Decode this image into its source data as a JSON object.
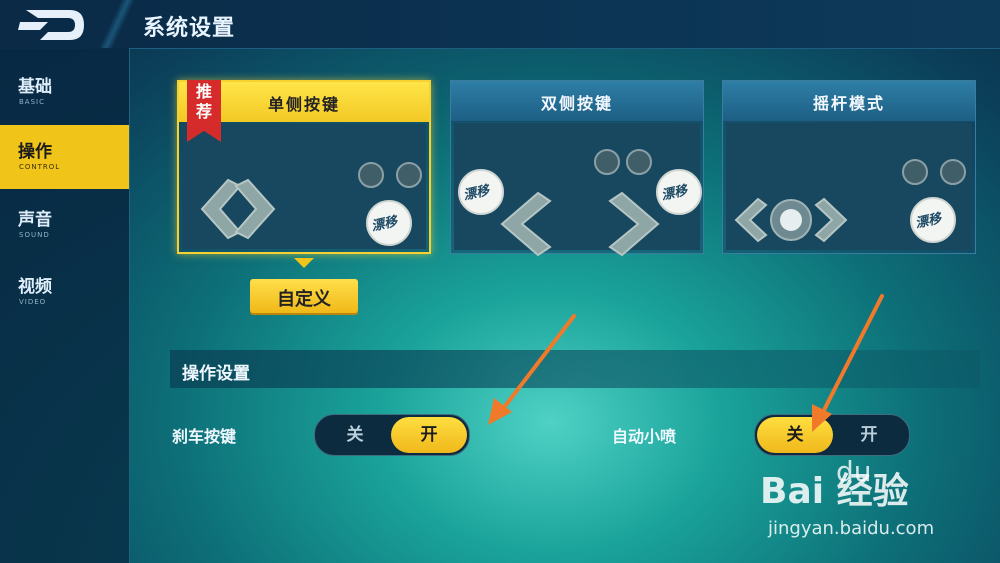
{
  "header": {
    "title": "系统设置"
  },
  "sidebar": {
    "items": [
      {
        "label": "基础",
        "sub": "BASIC",
        "active": false
      },
      {
        "label": "操作",
        "sub": "CONTROL",
        "active": true
      },
      {
        "label": "声音",
        "sub": "SOUND",
        "active": false
      },
      {
        "label": "视频",
        "sub": "VIDEO",
        "active": false
      }
    ]
  },
  "modes": {
    "single": {
      "label": "单侧按键",
      "badge": "推荐",
      "selected": true
    },
    "double": {
      "label": "双侧按键",
      "selected": false
    },
    "joystick": {
      "label": "摇杆模式",
      "selected": false
    },
    "drift_logo_text": "漂移"
  },
  "custom_button": {
    "label": "自定义"
  },
  "section": {
    "title": "操作设置"
  },
  "settings": {
    "brake": {
      "label": "刹车按键",
      "off_label": "关",
      "on_label": "开",
      "value": "开"
    },
    "auto_nitro": {
      "label": "自动小喷",
      "off_label": "关",
      "on_label": "开",
      "value": "关"
    }
  },
  "watermark": {
    "brand": "Bai  经验",
    "paw": "du",
    "url": "jingyan.baidu.com"
  },
  "colors": {
    "accent": "#f0c419",
    "highlight_arrow": "#f07a2a",
    "ribbon": "#d62b2b"
  }
}
